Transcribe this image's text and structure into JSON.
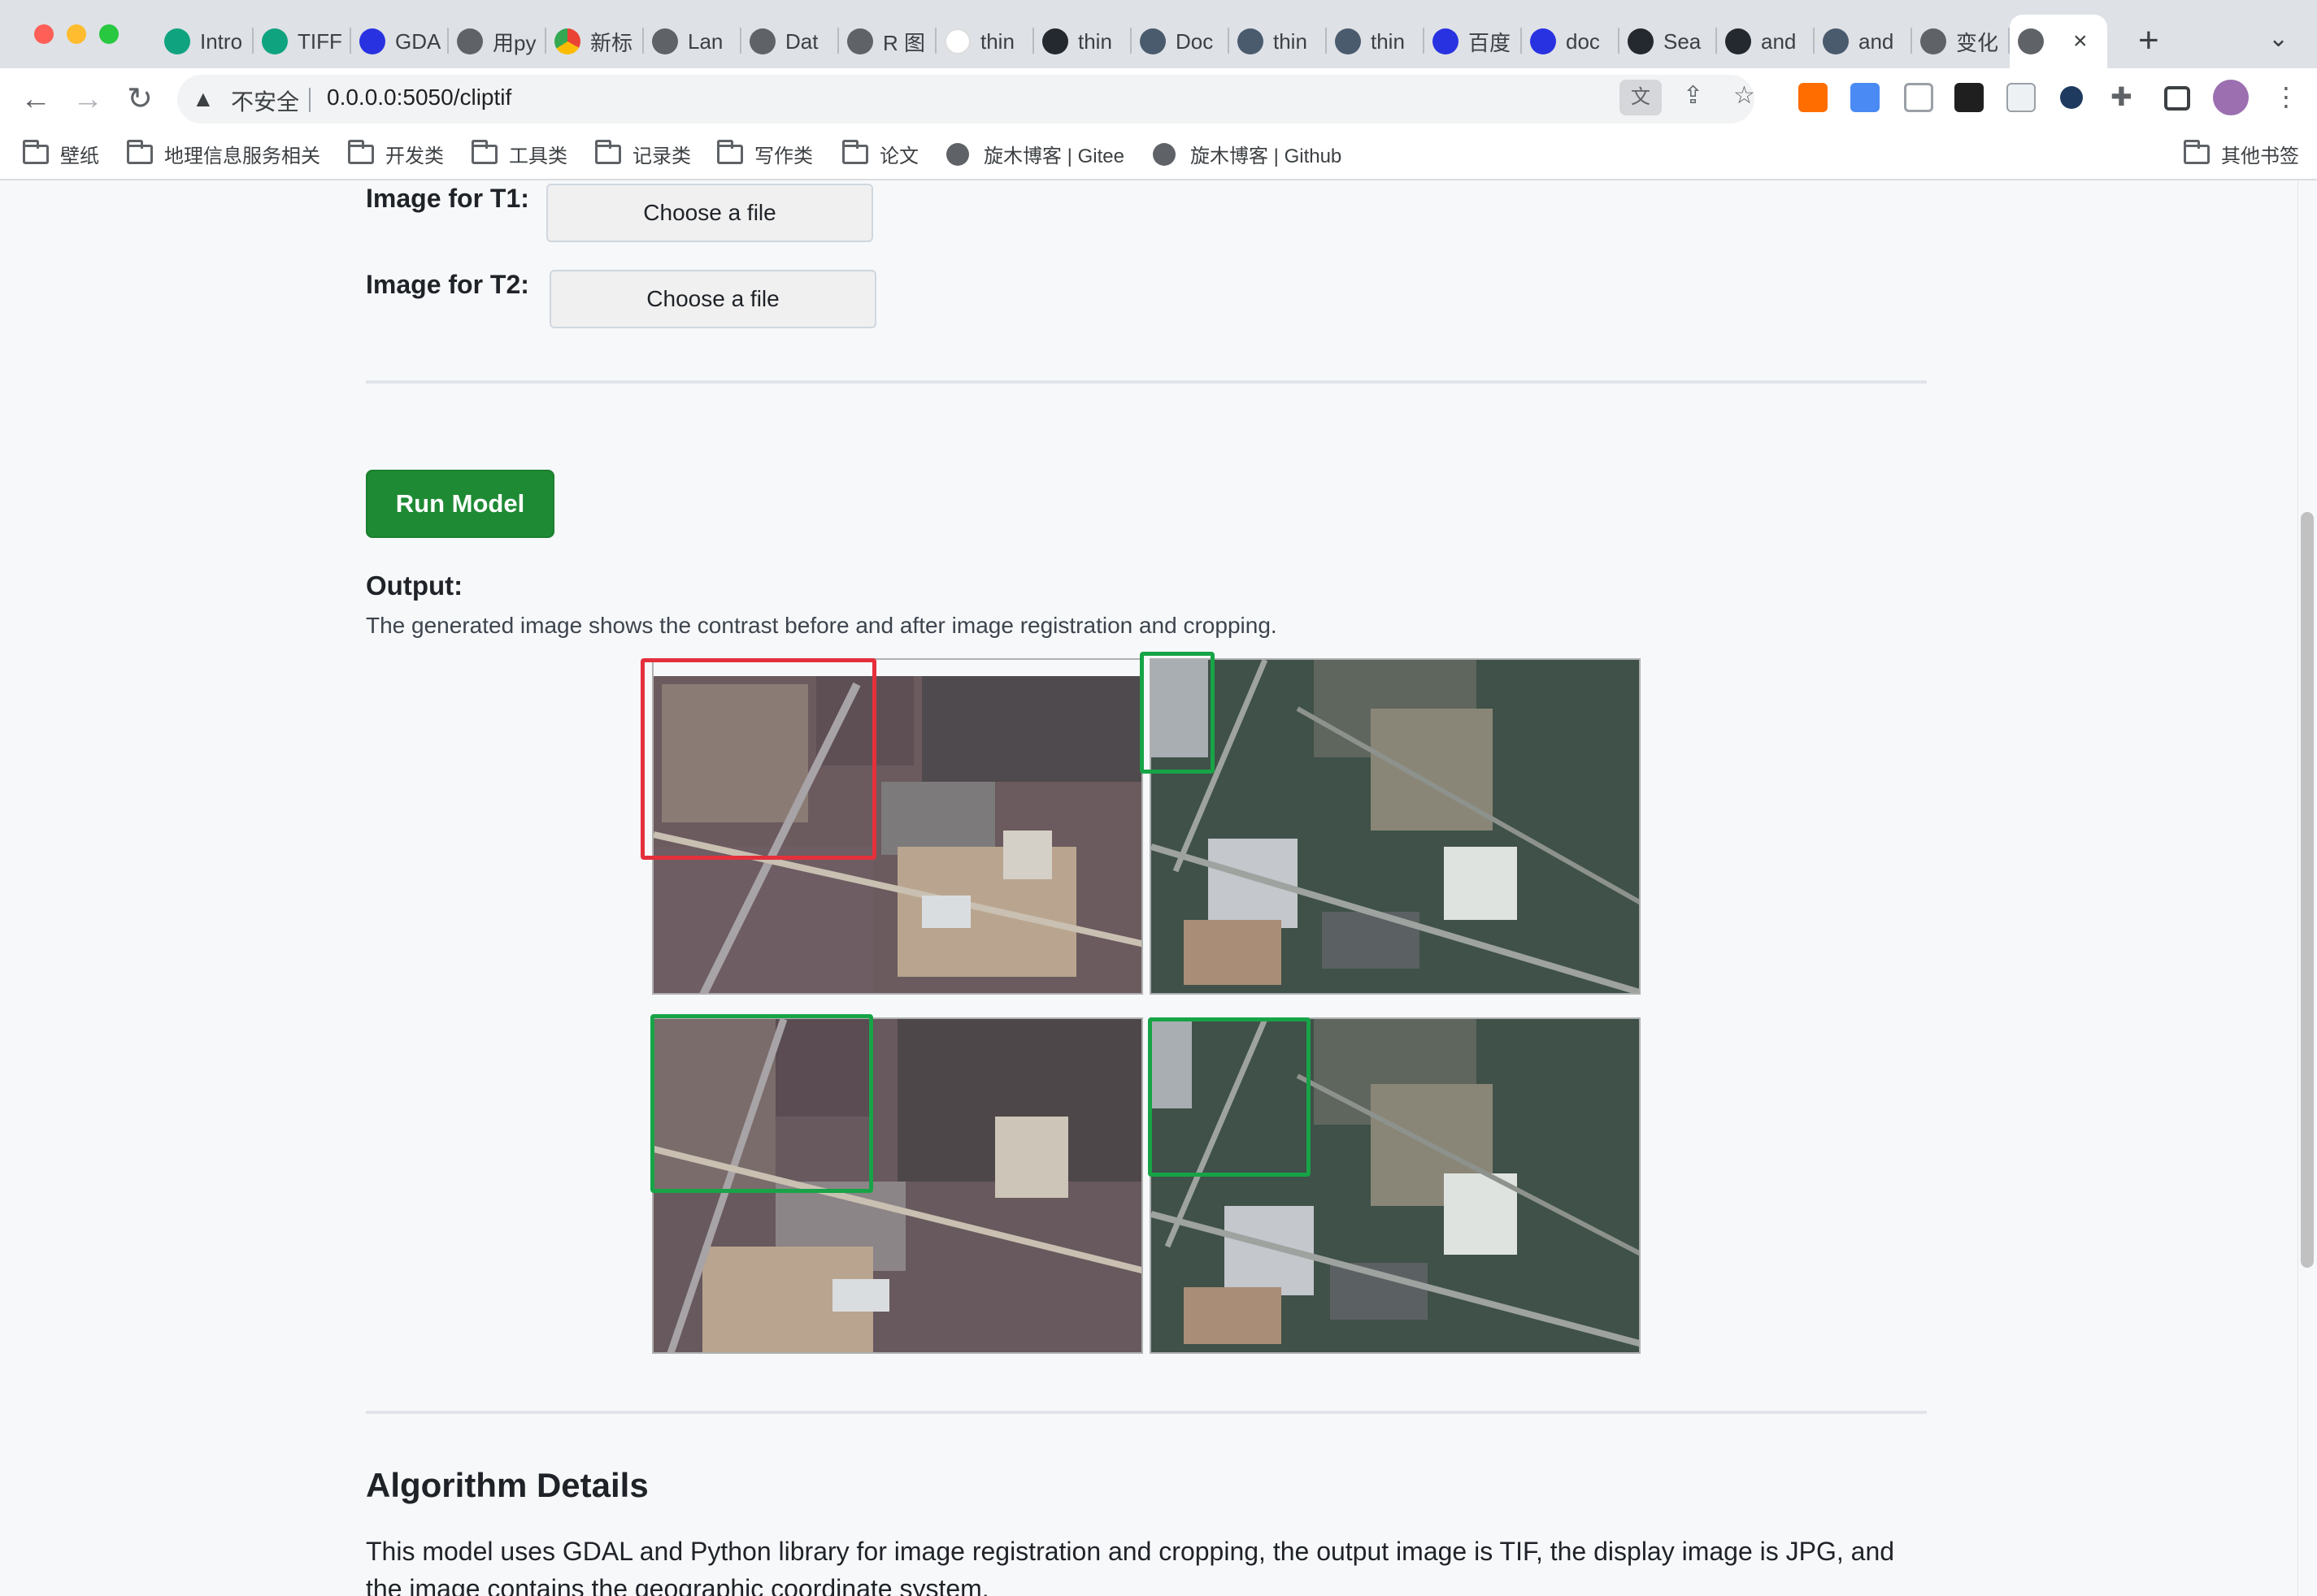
{
  "browser": {
    "tabs": [
      {
        "title": "Intro",
        "icon": "gpt"
      },
      {
        "title": "TIFF",
        "icon": "gpt"
      },
      {
        "title": "GDAL",
        "icon": "baidu"
      },
      {
        "title": "用py",
        "icon": "globe"
      },
      {
        "title": "新标",
        "icon": "chrome"
      },
      {
        "title": "Lan",
        "icon": "globe"
      },
      {
        "title": "Dat",
        "icon": "globe"
      },
      {
        "title": "R 图",
        "icon": "globe"
      },
      {
        "title": "thin",
        "icon": "goog"
      },
      {
        "title": "thin",
        "icon": "gh"
      },
      {
        "title": "Doc",
        "icon": "docker"
      },
      {
        "title": "thin",
        "icon": "docker"
      },
      {
        "title": "thin",
        "icon": "docker"
      },
      {
        "title": "百度",
        "icon": "baidu"
      },
      {
        "title": "doc",
        "icon": "baidu"
      },
      {
        "title": "Sea",
        "icon": "gh"
      },
      {
        "title": "and",
        "icon": "gh"
      },
      {
        "title": "and",
        "icon": "docker"
      },
      {
        "title": "变化",
        "icon": "globe"
      }
    ],
    "security_label": "不安全",
    "url": "0.0.0.0:5050/cliptif",
    "bookmarks": [
      {
        "label": "壁纸",
        "type": "folder"
      },
      {
        "label": "地理信息服务相关",
        "type": "folder"
      },
      {
        "label": "开发类",
        "type": "folder"
      },
      {
        "label": "工具类",
        "type": "folder"
      },
      {
        "label": "记录类",
        "type": "folder"
      },
      {
        "label": "写作类",
        "type": "folder"
      },
      {
        "label": "论文",
        "type": "folder"
      },
      {
        "label": "旋木博客 | Gitee",
        "type": "globe"
      },
      {
        "label": "旋木博客 | Github",
        "type": "globe"
      }
    ],
    "other_bookmarks": "其他书签"
  },
  "form": {
    "t1_label": "Image for T1:",
    "t2_label": "Image for T2:",
    "choose_file": "Choose a file",
    "run_label": "Run Model"
  },
  "output": {
    "title": "Output:",
    "description": "The generated image shows the contrast before and after image registration and cropping."
  },
  "algorithm": {
    "title": "Algorithm Details",
    "text": "This model uses GDAL and Python library for image registration and cropping, the output image is TIF, the display image is JPG, and the image contains the geographic coordinate system."
  },
  "colors": {
    "run_button": "#1f8a34",
    "highlight_red": "#e5303c",
    "highlight_green": "#17a447"
  }
}
